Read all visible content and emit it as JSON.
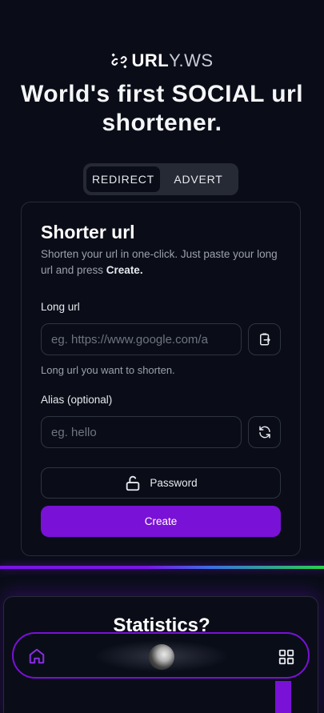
{
  "brand": {
    "strong": "URL",
    "light": "Y.WS"
  },
  "headline": {
    "before": "World's first ",
    "bold": "SOCIAL",
    "after": " url shortener."
  },
  "tabs": [
    {
      "label": "REDIRECT",
      "active": true
    },
    {
      "label": "ADVERT",
      "active": false
    }
  ],
  "form": {
    "title": "Shorter url",
    "description_before": "Shorten your url in one-click. Just paste your long url and press ",
    "description_bold": "Create.",
    "long_url": {
      "label": "Long url",
      "placeholder": "eg. https://www.google.com/a",
      "hint": "Long url you want to shorten."
    },
    "alias": {
      "label": "Alias (optional)",
      "placeholder": "eg. hello"
    },
    "password_label": "Password",
    "create_label": "Create"
  },
  "stats": {
    "title": "Statistics?"
  },
  "icons": {
    "logo": "broken-link-icon",
    "paste": "clipboard-paste-icon",
    "refresh": "refresh-icon",
    "lock": "unlock-icon",
    "home": "home-icon",
    "grid": "grid-icon"
  },
  "colors": {
    "background": "#0a0d18",
    "accent": "#7a11d6",
    "glow_green": "#27d24a"
  }
}
